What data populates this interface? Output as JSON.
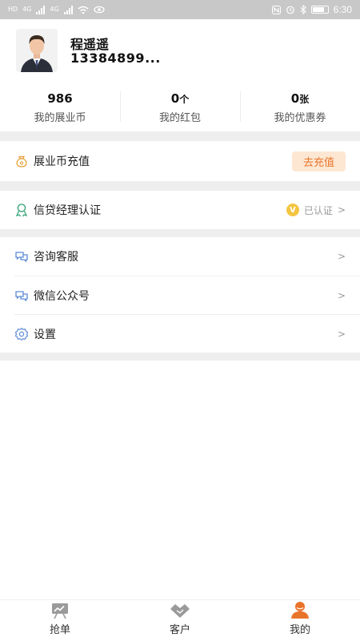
{
  "status_bar": {
    "carrier_tags": [
      "HD",
      "4G",
      "4G"
    ],
    "time": "6:30"
  },
  "profile": {
    "name": "程遥遥",
    "phone": "13384899..."
  },
  "stats": [
    {
      "value": "986",
      "unit": "",
      "label": "我的展业币"
    },
    {
      "value": "0",
      "unit": "个",
      "label": "我的红包"
    },
    {
      "value": "0",
      "unit": "张",
      "label": "我的优惠券"
    }
  ],
  "recharge": {
    "label": "展业币充值",
    "button": "去充值",
    "icon": "coin-bag-icon"
  },
  "certification": {
    "label": "信贷经理认证",
    "badge": "V",
    "status": "已认证",
    "chevron": ">",
    "icon": "award-icon"
  },
  "menu": [
    {
      "label": "咨询客服",
      "chevron": ">",
      "icon": "chat-icon"
    },
    {
      "label": "微信公众号",
      "chevron": ">",
      "icon": "chat-icon"
    },
    {
      "label": "设置",
      "chevron": ">",
      "icon": "gear-icon"
    }
  ],
  "bottom_nav": [
    {
      "label": "抢单",
      "icon": "chart-board-icon",
      "active": false
    },
    {
      "label": "客户",
      "icon": "handshake-icon",
      "active": false
    },
    {
      "label": "我的",
      "icon": "user-icon",
      "active": true
    }
  ],
  "colors": {
    "accent": "#e8742a",
    "accent_bg": "#fde7d3",
    "icon_blue": "#5b8bd6",
    "icon_green": "#3ba67a",
    "badge_gold": "#f3c542",
    "separator": "#eeeeee"
  }
}
